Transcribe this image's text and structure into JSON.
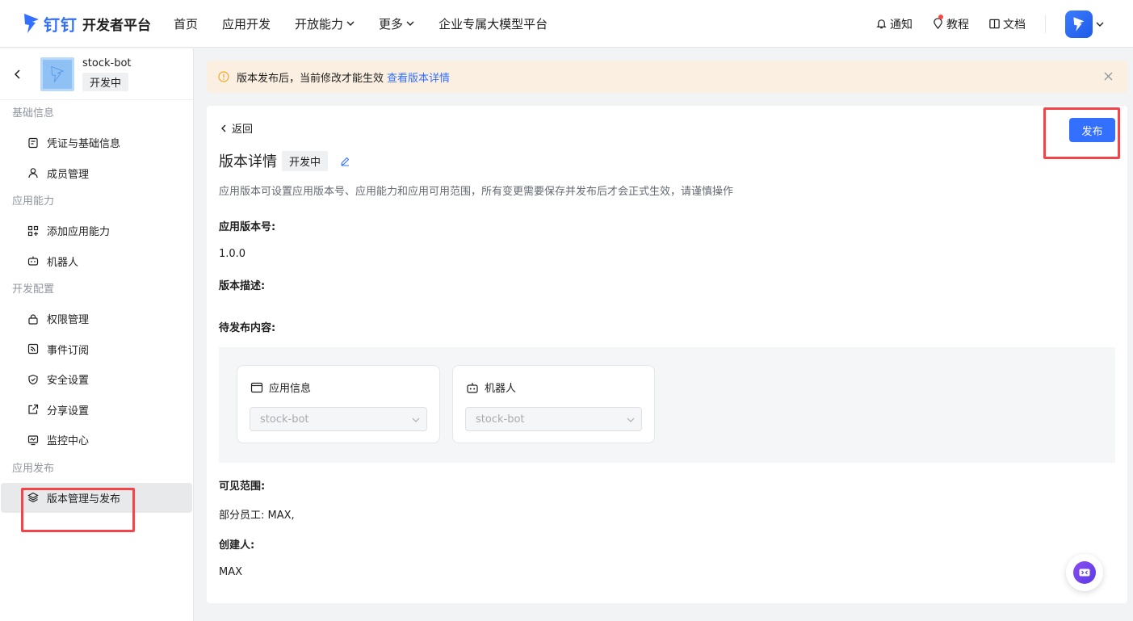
{
  "nav": {
    "brand": "钉钉",
    "sub": "开发者平台",
    "items": [
      {
        "label": "首页",
        "dropdown": false
      },
      {
        "label": "应用开发",
        "dropdown": false
      },
      {
        "label": "开放能力",
        "dropdown": true
      },
      {
        "label": "更多",
        "dropdown": true
      },
      {
        "label": "企业专属大模型平台",
        "dropdown": false
      }
    ],
    "right": {
      "notify": "通知",
      "tutorial": "教程",
      "docs": "文档"
    }
  },
  "app": {
    "name": "stock-bot",
    "status": "开发中"
  },
  "sidebar": {
    "sections": [
      {
        "title": "基础信息",
        "items": [
          {
            "label": "凭证与基础信息",
            "icon": "credential-icon"
          },
          {
            "label": "成员管理",
            "icon": "user-icon"
          }
        ]
      },
      {
        "title": "应用能力",
        "items": [
          {
            "label": "添加应用能力",
            "icon": "add-grid-icon"
          },
          {
            "label": "机器人",
            "icon": "robot-icon"
          }
        ]
      },
      {
        "title": "开发配置",
        "items": [
          {
            "label": "权限管理",
            "icon": "lock-icon"
          },
          {
            "label": "事件订阅",
            "icon": "rss-icon"
          },
          {
            "label": "安全设置",
            "icon": "shield-icon"
          },
          {
            "label": "分享设置",
            "icon": "share-icon"
          },
          {
            "label": "监控中心",
            "icon": "monitor-icon"
          }
        ]
      },
      {
        "title": "应用发布",
        "items": [
          {
            "label": "版本管理与发布",
            "icon": "layers-icon",
            "active": true
          }
        ]
      }
    ]
  },
  "alert": {
    "text": "版本发布后，当前修改才能生效",
    "link": "查看版本详情"
  },
  "detail": {
    "back": "返回",
    "title": "版本详情",
    "status": "开发中",
    "description": "应用版本可设置应用版本号、应用能力和应用可用范围，所有变更需要保存并发布后才会正式生效，请谨慎操作",
    "publish": "发布",
    "version_label": "应用版本号:",
    "version_value": "1.0.0",
    "desc_label": "版本描述:",
    "pending_label": "待发布内容:",
    "pending": [
      {
        "title": "应用信息",
        "icon": "app-window-icon",
        "value": "stock-bot"
      },
      {
        "title": "机器人",
        "icon": "robot-icon",
        "value": "stock-bot"
      }
    ],
    "scope_label": "可见范围:",
    "scope_value": "部分员工: MAX,",
    "creator_label": "创建人:",
    "creator_value": "MAX"
  },
  "colors": {
    "accent": "#3370ff",
    "highlight": "#f5434a",
    "alert_bg": "#fbefe1"
  }
}
